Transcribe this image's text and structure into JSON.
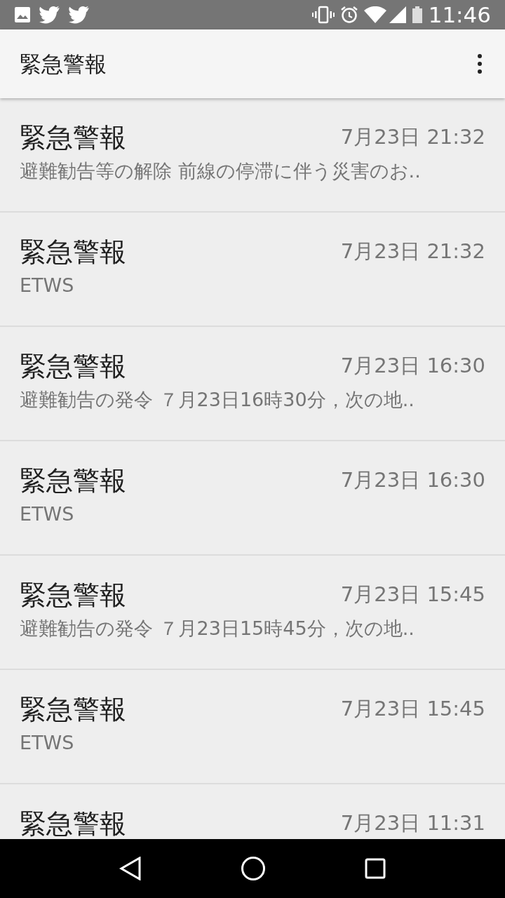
{
  "status_bar": {
    "time": "11:46"
  },
  "app_bar": {
    "title": "緊急警報"
  },
  "messages": [
    {
      "title": "緊急警報",
      "time": "7月23日 21:32",
      "preview": "避難勧告等の解除 前線の停滞に伴う災害のお.."
    },
    {
      "title": "緊急警報",
      "time": "7月23日 21:32",
      "preview": "ETWS"
    },
    {
      "title": "緊急警報",
      "time": "7月23日 16:30",
      "preview": "避難勧告の発令 ７月23日16時30分，次の地.."
    },
    {
      "title": "緊急警報",
      "time": "7月23日 16:30",
      "preview": "ETWS"
    },
    {
      "title": "緊急警報",
      "time": "7月23日 15:45",
      "preview": "避難勧告の発令 ７月23日15時45分，次の地.."
    },
    {
      "title": "緊急警報",
      "time": "7月23日 15:45",
      "preview": "ETWS"
    },
    {
      "title": "緊急警報",
      "time": "7月23日 11:31"
    }
  ]
}
